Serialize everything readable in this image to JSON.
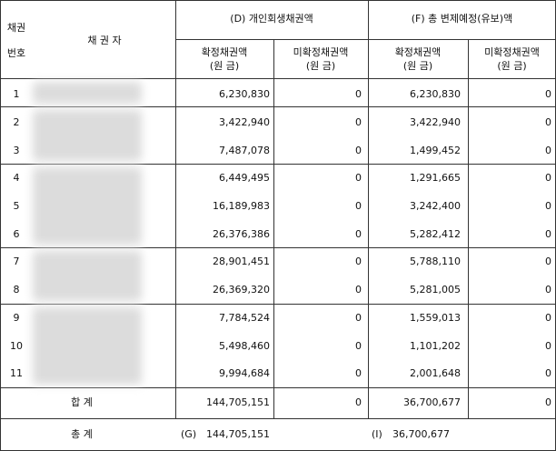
{
  "header": {
    "no_line1": "채권",
    "no_line2": "번호",
    "creditor": "채 권 자",
    "group_d": "(D) 개인회생채권액",
    "group_f": "(F) 총 변제예정(유보)액",
    "confirmed": "확정채권액",
    "unconfirmed": "미확정채권액",
    "principal": "(원 금)"
  },
  "rows": [
    {
      "no": "1",
      "d_conf": "6,230,830",
      "d_unconf": "0",
      "f_conf": "6,230,830",
      "f_unconf": "0"
    },
    {
      "no": "2",
      "d_conf": "3,422,940",
      "d_unconf": "0",
      "f_conf": "3,422,940",
      "f_unconf": "0"
    },
    {
      "no": "3",
      "d_conf": "7,487,078",
      "d_unconf": "0",
      "f_conf": "1,499,452",
      "f_unconf": "0"
    },
    {
      "no": "4",
      "d_conf": "6,449,495",
      "d_unconf": "0",
      "f_conf": "1,291,665",
      "f_unconf": "0"
    },
    {
      "no": "5",
      "d_conf": "16,189,983",
      "d_unconf": "0",
      "f_conf": "3,242,400",
      "f_unconf": "0"
    },
    {
      "no": "6",
      "d_conf": "26,376,386",
      "d_unconf": "0",
      "f_conf": "5,282,412",
      "f_unconf": "0"
    },
    {
      "no": "7",
      "d_conf": "28,901,451",
      "d_unconf": "0",
      "f_conf": "5,788,110",
      "f_unconf": "0"
    },
    {
      "no": "8",
      "d_conf": "26,369,320",
      "d_unconf": "0",
      "f_conf": "5,281,005",
      "f_unconf": "0"
    },
    {
      "no": "9",
      "d_conf": "7,784,524",
      "d_unconf": "0",
      "f_conf": "1,559,013",
      "f_unconf": "0"
    },
    {
      "no": "10",
      "d_conf": "5,498,460",
      "d_unconf": "0",
      "f_conf": "1,101,202",
      "f_unconf": "0"
    },
    {
      "no": "11",
      "d_conf": "9,994,684",
      "d_unconf": "0",
      "f_conf": "2,001,648",
      "f_unconf": "0"
    }
  ],
  "sum": {
    "label": "합 계",
    "d_conf": "144,705,151",
    "d_unconf": "0",
    "f_conf": "36,700,677",
    "f_unconf": "0"
  },
  "total": {
    "label": "총 계",
    "g_tag": "(G)",
    "g_value": "144,705,151",
    "i_tag": "(I)",
    "i_value": "36,700,677"
  }
}
